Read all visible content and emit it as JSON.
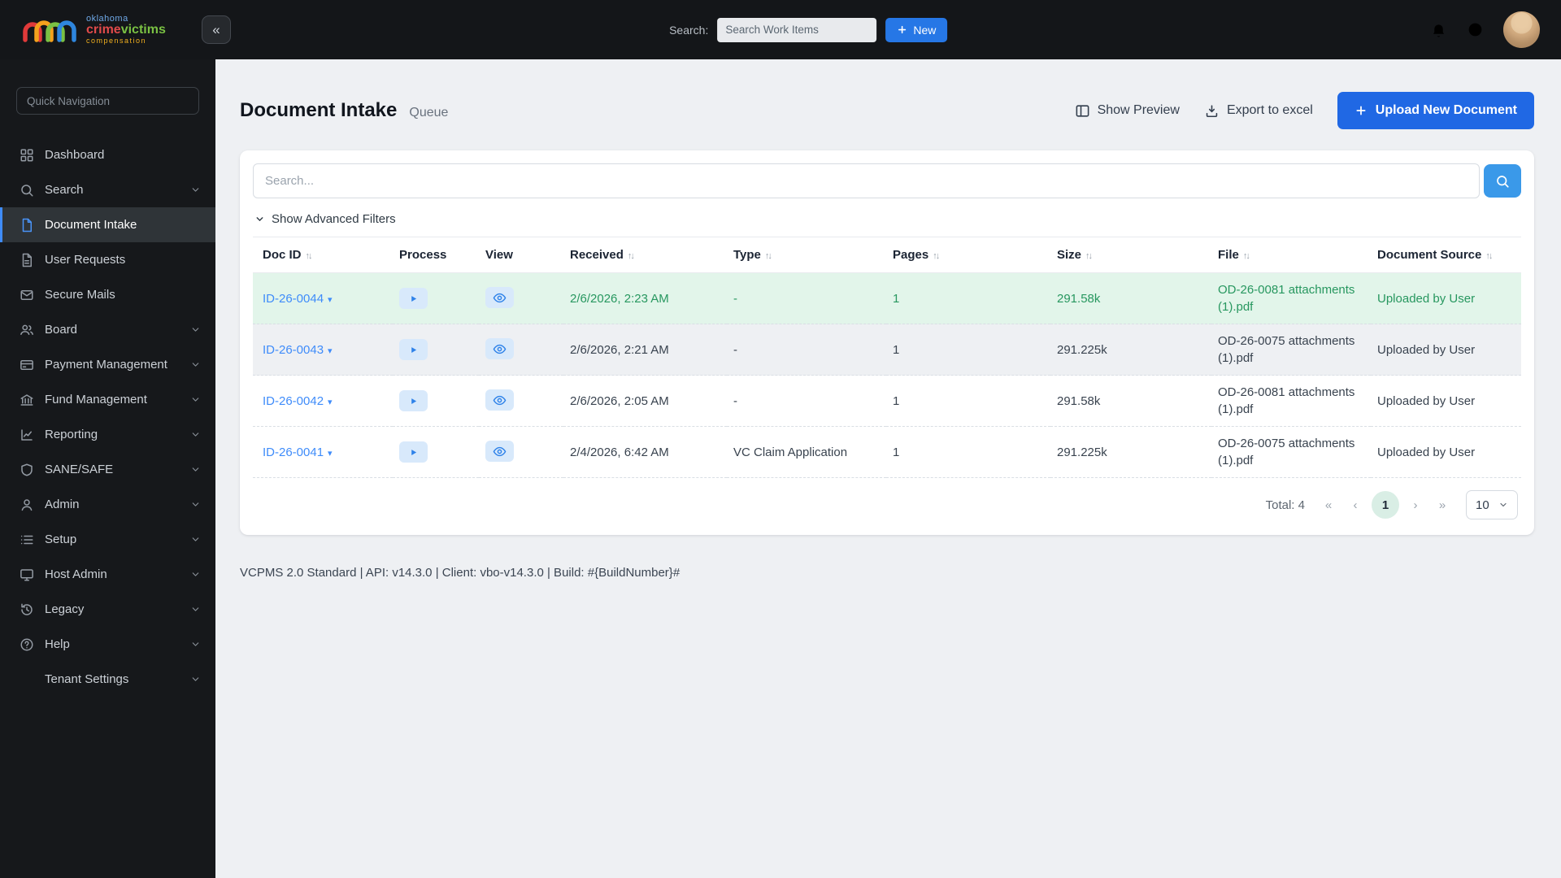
{
  "topbar": {
    "logo_line1": "oklahoma",
    "logo_line2a": "crime",
    "logo_line2b": "victims",
    "logo_line3": "compensation",
    "search_label": "Search:",
    "search_placeholder": "Search Work Items",
    "new_label": "New"
  },
  "sidebar": {
    "quick_nav_placeholder": "Quick Navigation",
    "items": [
      {
        "label": "Dashboard"
      },
      {
        "label": "Search"
      },
      {
        "label": "Document Intake"
      },
      {
        "label": "User Requests"
      },
      {
        "label": "Secure Mails"
      },
      {
        "label": "Board"
      },
      {
        "label": "Payment Management"
      },
      {
        "label": "Fund Management"
      },
      {
        "label": "Reporting"
      },
      {
        "label": "SANE/SAFE"
      },
      {
        "label": "Admin"
      },
      {
        "label": "Setup"
      },
      {
        "label": "Host Admin"
      },
      {
        "label": "Legacy"
      },
      {
        "label": "Help"
      },
      {
        "label": "Tenant Settings"
      }
    ]
  },
  "page": {
    "title": "Document Intake",
    "subtitle": "Queue",
    "show_preview": "Show Preview",
    "export_excel": "Export to excel",
    "upload_new": "Upload New Document"
  },
  "table": {
    "search_placeholder": "Search...",
    "advanced_filters": "Show Advanced Filters",
    "headers": [
      "Doc ID",
      "Process",
      "View",
      "Received",
      "Type",
      "Pages",
      "Size",
      "File",
      "Document Source"
    ],
    "rows": [
      {
        "doc_id": "ID-26-0044",
        "received": "2/6/2026, 2:23 AM",
        "type": "-",
        "pages": "1",
        "size": "291.58k",
        "file": "OD-26-0081 attachments (1).pdf",
        "source": "Uploaded by User"
      },
      {
        "doc_id": "ID-26-0043",
        "received": "2/6/2026, 2:21 AM",
        "type": "-",
        "pages": "1",
        "size": "291.225k",
        "file": "OD-26-0075 attachments (1).pdf",
        "source": "Uploaded by User"
      },
      {
        "doc_id": "ID-26-0042",
        "received": "2/6/2026, 2:05 AM",
        "type": "-",
        "pages": "1",
        "size": "291.58k",
        "file": "OD-26-0081 attachments (1).pdf",
        "source": "Uploaded by User"
      },
      {
        "doc_id": "ID-26-0041",
        "received": "2/4/2026, 6:42 AM",
        "type": "VC Claim Application",
        "pages": "1",
        "size": "291.225k",
        "file": "OD-26-0075 attachments (1).pdf",
        "source": "Uploaded by User"
      }
    ],
    "pagination": {
      "total": "Total: 4",
      "prev_all": "«",
      "prev": "‹",
      "current_page": "1",
      "next": "›",
      "next_all": "»",
      "page_size": "10"
    }
  },
  "footer": {
    "text": "VCPMS 2.0 Standard | API: v14.3.0 | Client: vbo-v14.3.0 | Build: #{BuildNumber}#"
  },
  "colors": {
    "accent_blue": "#2068e4",
    "search_button_blue": "#3a99e9",
    "link_blue": "#3f8cfa",
    "row_highlight_green": "#e2f5ea",
    "sidebar_dark": "#16181b",
    "active_green_text": "#27975f"
  }
}
